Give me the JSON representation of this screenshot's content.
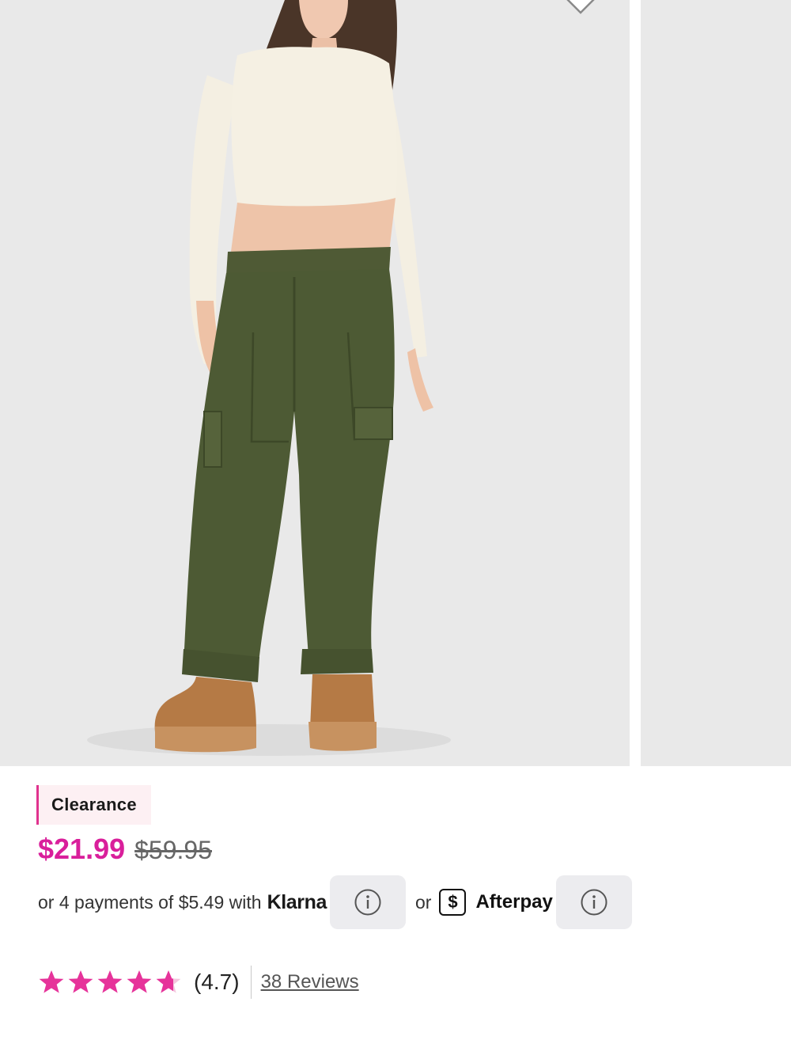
{
  "product": {
    "badge": "Clearance",
    "sale_price": "$21.99",
    "original_price": "$59.95"
  },
  "payments": {
    "klarna_text": "or 4 payments of $5.49 with",
    "klarna_brand": "Klarna",
    "or_text": "or",
    "afterpay_symbol": "$",
    "afterpay_brand": "Afterpay",
    "info_icon": "info-icon"
  },
  "rating": {
    "score": 4.7,
    "score_text": "(4.7)",
    "reviews_text": "38 Reviews",
    "max_stars": 5
  },
  "gallery": {
    "progress_fraction": 0.25
  },
  "colors": {
    "accent_pink": "#d91f9b",
    "star_pink": "#e6339a",
    "badge_bg": "#fdf0f3",
    "image_bg": "#e9e9e9"
  }
}
